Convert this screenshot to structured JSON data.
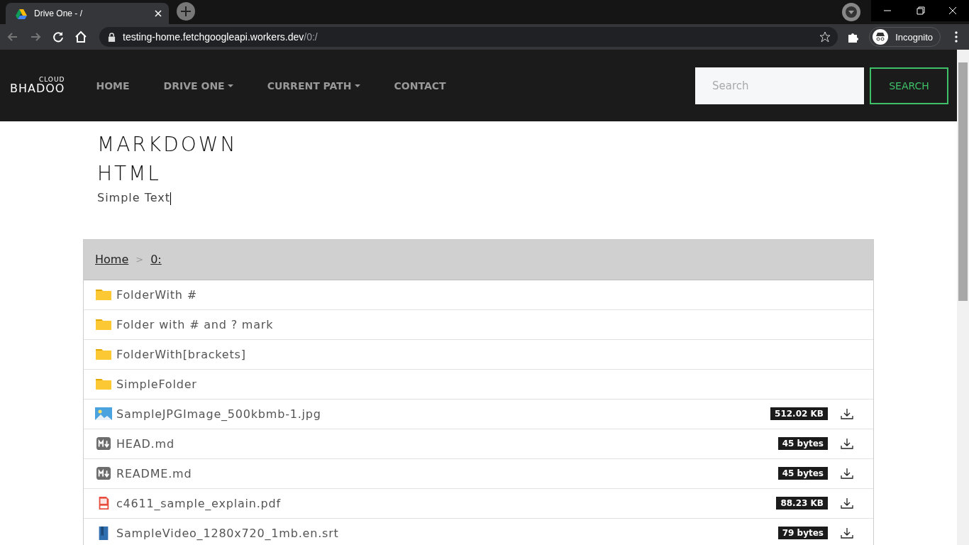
{
  "browser": {
    "tab_title": "Drive One - /",
    "url_host": "testing-home.fetchgoogleapi.workers.dev",
    "url_path": "/0:/",
    "profile": "Incognito"
  },
  "navbar": {
    "brand_top": "CLOUD",
    "brand": "BHADOO",
    "links": [
      {
        "label": "HOME",
        "dropdown": false
      },
      {
        "label": "DRIVE ONE",
        "dropdown": true
      },
      {
        "label": "CURRENT PATH",
        "dropdown": true
      },
      {
        "label": "CONTACT",
        "dropdown": false
      }
    ],
    "search": {
      "placeholder": "Search",
      "button": "SEARCH"
    }
  },
  "readme": {
    "headings": [
      "MARKDOWN",
      "HTML"
    ],
    "text": "Simple Text"
  },
  "breadcrumb": {
    "items": [
      "Home",
      "0:"
    ],
    "separator": ">"
  },
  "files": [
    {
      "kind": "folder",
      "name": "FolderWith #"
    },
    {
      "kind": "folder",
      "name": "Folder with # and ? mark"
    },
    {
      "kind": "folder",
      "name": "FolderWith[brackets]"
    },
    {
      "kind": "folder",
      "name": "SimpleFolder"
    },
    {
      "kind": "image",
      "name": "SampleJPGImage_500kbmb-1.jpg",
      "size": "512.02 KB"
    },
    {
      "kind": "markdown",
      "name": "HEAD.md",
      "size": "45 bytes"
    },
    {
      "kind": "markdown",
      "name": "README.md",
      "size": "45 bytes"
    },
    {
      "kind": "pdf",
      "name": "c4611_sample_explain.pdf",
      "size": "88.23 KB"
    },
    {
      "kind": "subtitle",
      "name": "SampleVideo_1280x720_1mb.en.srt",
      "size": "79 bytes"
    }
  ]
}
